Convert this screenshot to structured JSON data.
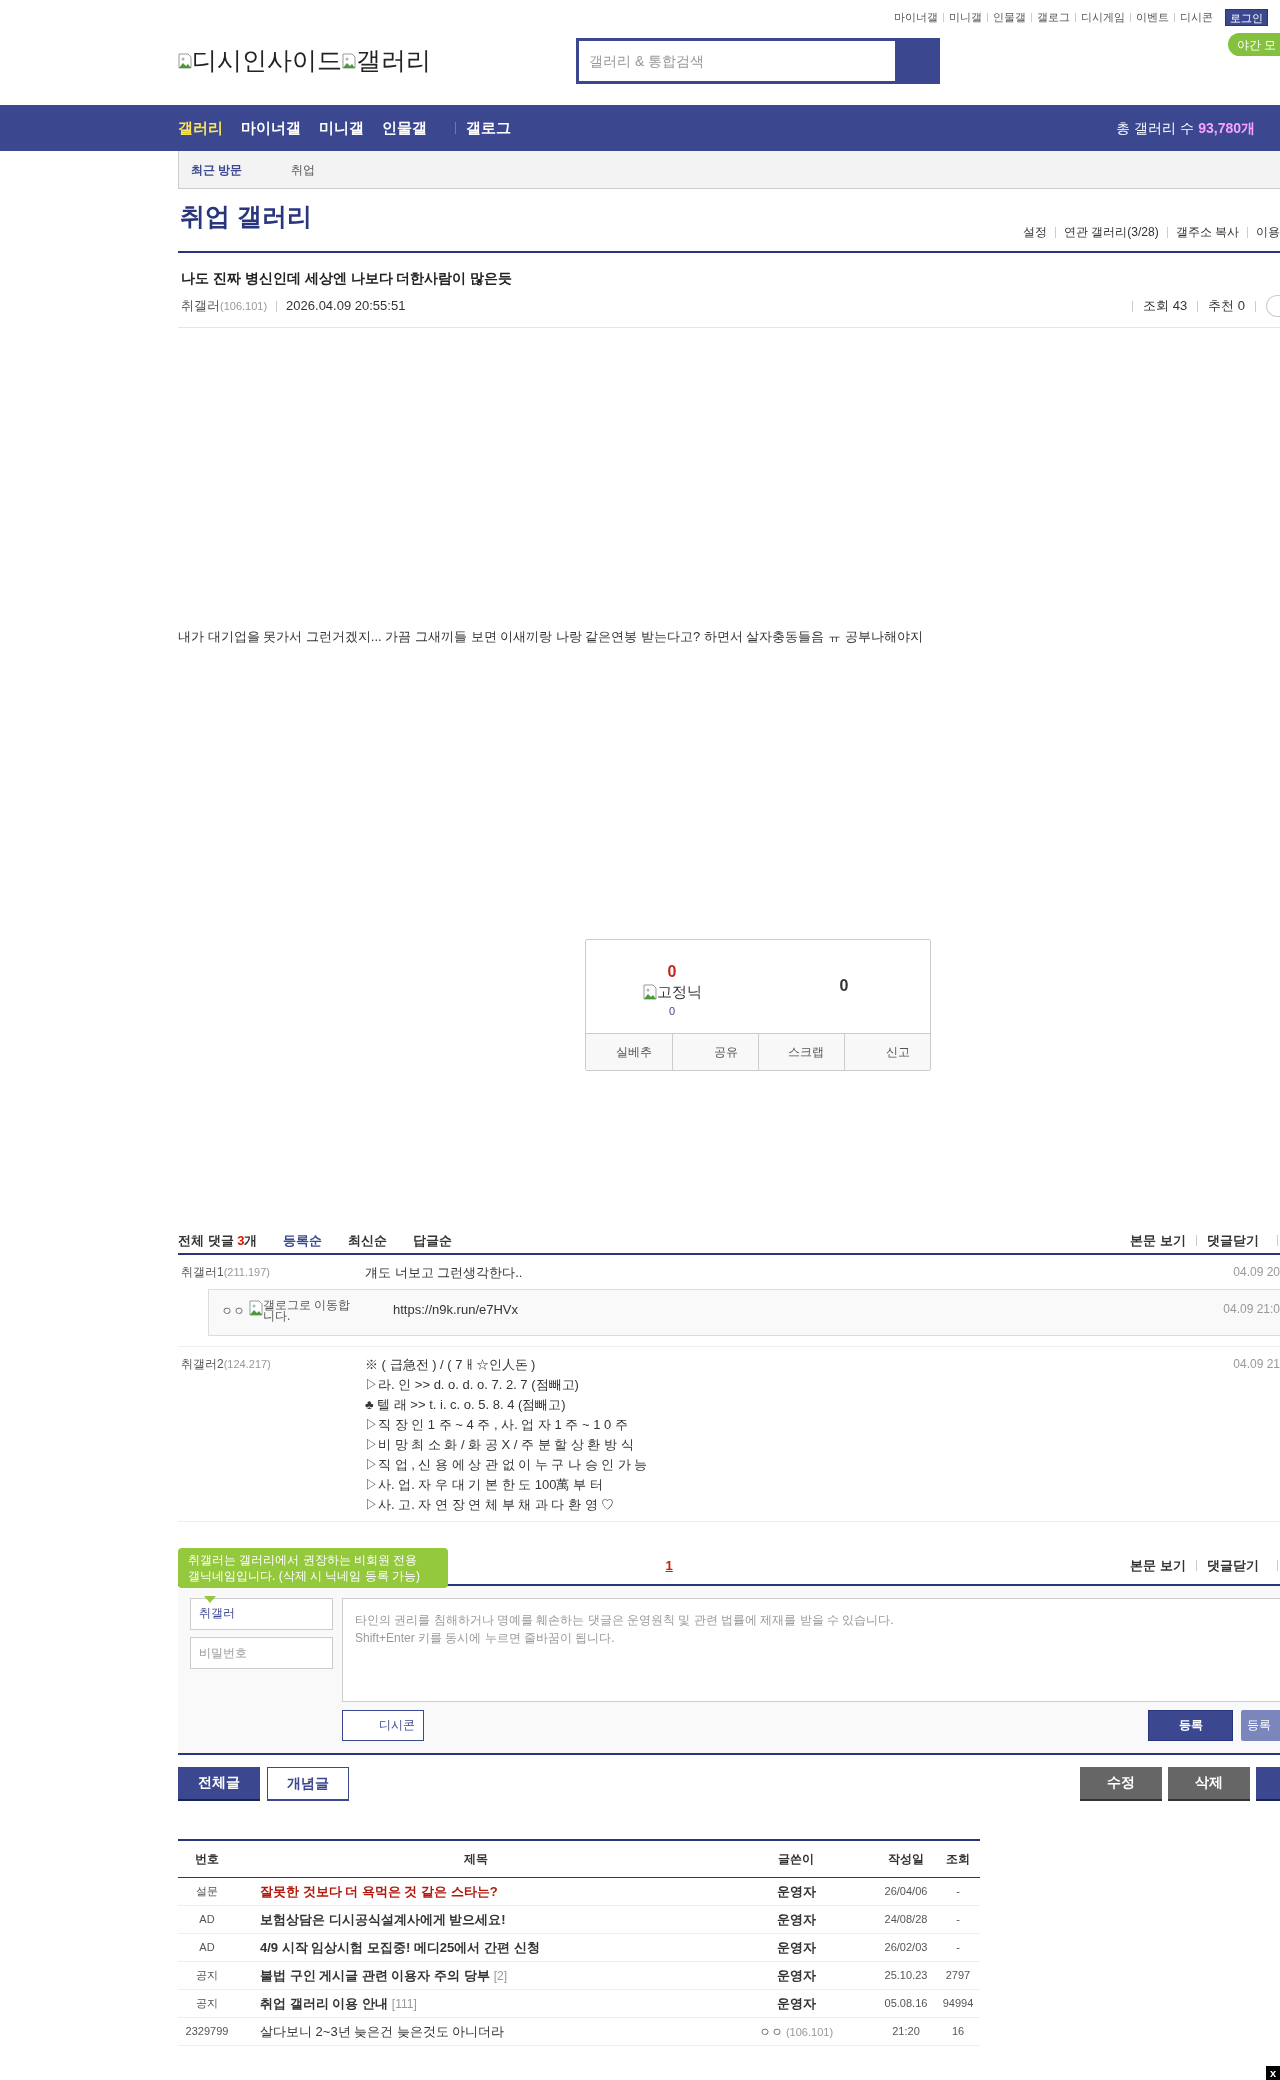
{
  "header": {
    "logo_alt": [
      "디시인사이드",
      "갤러리"
    ],
    "top_links": [
      "마이너갤",
      "미니갤",
      "인물갤",
      "갤로그",
      "디시게임",
      "이벤트",
      "디시콘"
    ],
    "login": "로그인",
    "night_mode": "야간 모",
    "search": {
      "placeholder": "갤러리 & 통합검색"
    }
  },
  "nav": {
    "items": [
      {
        "label": "갤러리",
        "selected": true
      },
      {
        "label": "마이너갤",
        "selected": false
      },
      {
        "label": "미니갤",
        "selected": false
      },
      {
        "label": "인물갤",
        "selected": false
      },
      {
        "label": "갤로그",
        "selected": false
      }
    ],
    "total_label": "총 갤러리 수",
    "total_value": "93,780개"
  },
  "subnav": {
    "title": "최근 방문",
    "items": [
      "취업"
    ]
  },
  "gallery": {
    "title": "취업 갤러리",
    "links": [
      "설정",
      "연관 갤러리(3/28)",
      "갤주소 복사",
      "이용"
    ]
  },
  "post": {
    "title": "나도 진짜 병신인데 세상엔 나보다 더한사람이 많은듯",
    "author": "취갤러",
    "ip": "(106.101)",
    "date": "2026.04.09 20:55:51",
    "views": "조회 43",
    "recommend": "추천 0",
    "body": "내가 대기업을 못가서 그런거겠지... 가끔 그새끼들 보면 이새끼랑 나랑 같은연봉 받는다고? 하면서 살자충동들음 ㅠ 공부나해야지"
  },
  "vote": {
    "up_count": "0",
    "fixed_alt": "고정닉",
    "fixed_count": "0",
    "down_count": "0",
    "actions": [
      "실베추",
      "공유",
      "스크랩",
      "신고"
    ]
  },
  "comments": {
    "label": "전체 댓글",
    "count": "3",
    "unit": "개",
    "sorts": [
      {
        "label": "등록순",
        "selected": true
      },
      {
        "label": "최신순",
        "selected": false
      },
      {
        "label": "답글순",
        "selected": false
      }
    ],
    "links": [
      "본문 보기",
      "댓글닫기"
    ],
    "items": [
      {
        "author": "취갤러1",
        "ip": "(211.197)",
        "lines": [
          "걔도 너보고 그런생각한다.."
        ],
        "date": "04.09 20",
        "replies": [
          {
            "author": "ㅇㅇ",
            "gallog_alt": "갤로그로 이동합니다.",
            "text": "https://n9k.run/e7HVx",
            "date": "04.09 21:0"
          }
        ]
      },
      {
        "author": "취갤러2",
        "ip": "(124.217)",
        "lines": [
          "※ ( 급急전 ) / ( 7ㅐ☆인人돈 )",
          "▷라. 인 >> d. o. d. o. 7. 2. 7 (점빼고)",
          "♣ 텔 래 >> t. i. c. o. 5. 8. 4 (점빼고)",
          "▷직 장 인 1 주 ~ 4 주 , 사. 업 자 1 주 ~ 1 0 주",
          "▷비 망 최 소 화 / 화 공 X / 주 분 할 상 환 방 식",
          "▷직 업 , 신 용 에 상 관 없 이 누 구 나 승 인 가 능",
          "▷사. 업. 자 우 대 기 본 한 도 100萬 부 터",
          "▷사. 고. 자 연 장 연 체 부 채 과 다 환 영 ♡"
        ],
        "date": "04.09 21"
      }
    ],
    "pages": [
      {
        "label": "1",
        "selected": true
      }
    ],
    "bottom_links": [
      "본문 보기",
      "댓글닫기"
    ]
  },
  "form": {
    "tooltip": [
      "취갤러는 갤러리에서 권장하는 비회원 전용",
      "갤닉네임입니다. (삭제 시 닉네임 등록 가능)"
    ],
    "name_value": "취갤러",
    "password_placeholder": "비밀번호",
    "placeholder": "타인의 권리를 침해하거나 명예를 훼손하는 댓글은 운영원칙 및 관련 법률에 제재를 받을 수 있습니다.\nShift+Enter 키를 동시에 누르면 줄바꿈이 됩니다.",
    "dccon": "디시콘",
    "submit": "등록",
    "submit_alt": "등록"
  },
  "buttons_left": [
    {
      "label": "전체글",
      "kind": "primary"
    },
    {
      "label": "개념글",
      "kind": "outline"
    }
  ],
  "buttons_right": [
    {
      "label": "수정",
      "kind": "gray"
    },
    {
      "label": "삭제",
      "kind": "gray"
    },
    {
      "kind": "primary"
    }
  ],
  "table": {
    "columns": [
      "번호",
      "제목",
      "글쓴이",
      "작성일",
      "조회"
    ],
    "rows": [
      {
        "num": "설문",
        "kind": "survey",
        "title": "잘못한 것보다 더 욕먹은 것 같은 스타는?",
        "writer": "운영자",
        "date": "26/04/06",
        "views": "-"
      },
      {
        "num": "AD",
        "kind": "notice",
        "title": "보험상담은 디시공식설계사에게 받으세요!",
        "writer": "운영자",
        "date": "24/08/28",
        "views": "-"
      },
      {
        "num": "AD",
        "kind": "notice",
        "title": "4/9 시작 임상시험 모집중! 메디25에서 간편 신청",
        "writer": "운영자",
        "date": "26/02/03",
        "views": "-"
      },
      {
        "num": "공지",
        "kind": "notice",
        "title": "불법 구인 게시글 관련 이용자 주의 당부",
        "reply_count": "[2]",
        "writer": "운영자",
        "date": "25.10.23",
        "views": "2797"
      },
      {
        "num": "공지",
        "kind": "notice",
        "title": "취업 갤러리 이용 안내",
        "reply_count": "[111]",
        "writer": "운영자",
        "date": "05.08.16",
        "views": "94994"
      },
      {
        "num": "2329799",
        "kind": "normal",
        "title": "살다보니 2~3년 늦은건 늦은것도 아니더라",
        "writer": "ㅇㅇ",
        "ip": "(106.101)",
        "date": "21:20",
        "views": "16"
      }
    ]
  },
  "close_ad": "x"
}
